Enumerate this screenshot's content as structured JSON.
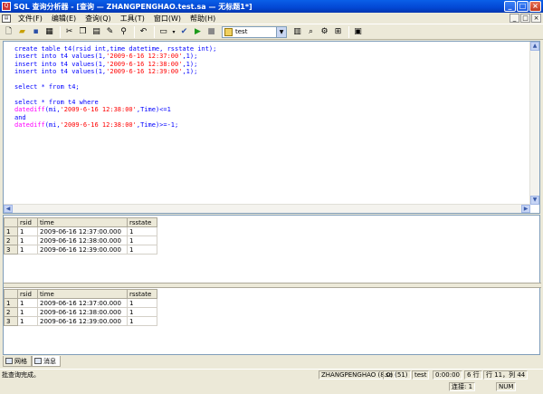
{
  "window": {
    "title": "SQL 查询分析器 - [查询 — ZHANGPENGHAO.test.sa — 无标题1*]",
    "controls": [
      "_",
      "□",
      "×"
    ]
  },
  "menu": {
    "items": [
      "文件(F)",
      "编辑(E)",
      "查询(Q)",
      "工具(T)",
      "窗口(W)",
      "帮助(H)"
    ],
    "mdi_controls": [
      "_",
      "□",
      "×"
    ]
  },
  "toolbar": {
    "database": "test",
    "icons": [
      "new-query-icon",
      "open-icon",
      "save-icon",
      "insert-template-icon",
      "cut-icon",
      "copy-icon",
      "paste-icon",
      "clear-icon",
      "find-icon",
      "undo-icon",
      "result-mode-icon",
      "parse-icon",
      "execute-icon",
      "stop-icon",
      "object-browser-icon",
      "object-search-icon",
      "properties-icon",
      "show-plan-icon",
      "show-results-icon"
    ]
  },
  "editor": {
    "lines": [
      [
        {
          "t": "create table t4(rsid int,time datetime, rsstate int);",
          "c": "kw"
        }
      ],
      [
        {
          "t": "insert into t4 values(1,",
          "c": "kw"
        },
        {
          "t": "'2009-6-16 12:37:00'",
          "c": "str"
        },
        {
          "t": ",1);",
          "c": "kw"
        }
      ],
      [
        {
          "t": "insert into t4 values(1,",
          "c": "kw"
        },
        {
          "t": "'2009-6-16 12:38:00'",
          "c": "str"
        },
        {
          "t": ",1);",
          "c": "kw"
        }
      ],
      [
        {
          "t": "insert into t4 values(1,",
          "c": "kw"
        },
        {
          "t": "'2009-6-16 12:39:00'",
          "c": "str"
        },
        {
          "t": ",1);",
          "c": "kw"
        }
      ],
      [
        {
          "t": "",
          "c": "kw"
        }
      ],
      [
        {
          "t": "select * from t4;",
          "c": "kw"
        }
      ],
      [
        {
          "t": "",
          "c": "kw"
        }
      ],
      [
        {
          "t": "select * from t4 where",
          "c": "kw"
        }
      ],
      [
        {
          "t": "datediff",
          "c": "fn"
        },
        {
          "t": "(mi,",
          "c": "kw"
        },
        {
          "t": "'2009-6-16 12:38:00'",
          "c": "str"
        },
        {
          "t": ",Time)<=1",
          "c": "kw"
        }
      ],
      [
        {
          "t": "and",
          "c": "kw"
        }
      ],
      [
        {
          "t": "datediff",
          "c": "fn"
        },
        {
          "t": "(mi,",
          "c": "kw"
        },
        {
          "t": "'2009-6-16 12:38:00'",
          "c": "str"
        },
        {
          "t": ",Time)>=-1;",
          "c": "kw"
        }
      ]
    ]
  },
  "results": [
    {
      "columns": [
        "rsid",
        "time",
        "rsstate"
      ],
      "rows": [
        [
          "1",
          "1",
          "2009-06-16 12:37:00.000",
          "1"
        ],
        [
          "2",
          "1",
          "2009-06-16 12:38:00.000",
          "1"
        ],
        [
          "3",
          "1",
          "2009-06-16 12:39:00.000",
          "1"
        ]
      ]
    },
    {
      "columns": [
        "rsid",
        "time",
        "rsstate"
      ],
      "rows": [
        [
          "1",
          "1",
          "2009-06-16 12:37:00.000",
          "1"
        ],
        [
          "2",
          "1",
          "2009-06-16 12:38:00.000",
          "1"
        ],
        [
          "3",
          "1",
          "2009-06-16 12:39:00.000",
          "1"
        ]
      ]
    }
  ],
  "result_tabs": {
    "grid": "网格",
    "messages": "消息"
  },
  "status": {
    "message": "批查询完成。",
    "server": "ZHANGPENGHAO (8.0)",
    "user": "sa (51)",
    "database": "test",
    "elapsed": "0:00:00",
    "rows": "6 行",
    "position": "行 11，列 44",
    "connections": "连接: 1",
    "num": "NUM"
  }
}
